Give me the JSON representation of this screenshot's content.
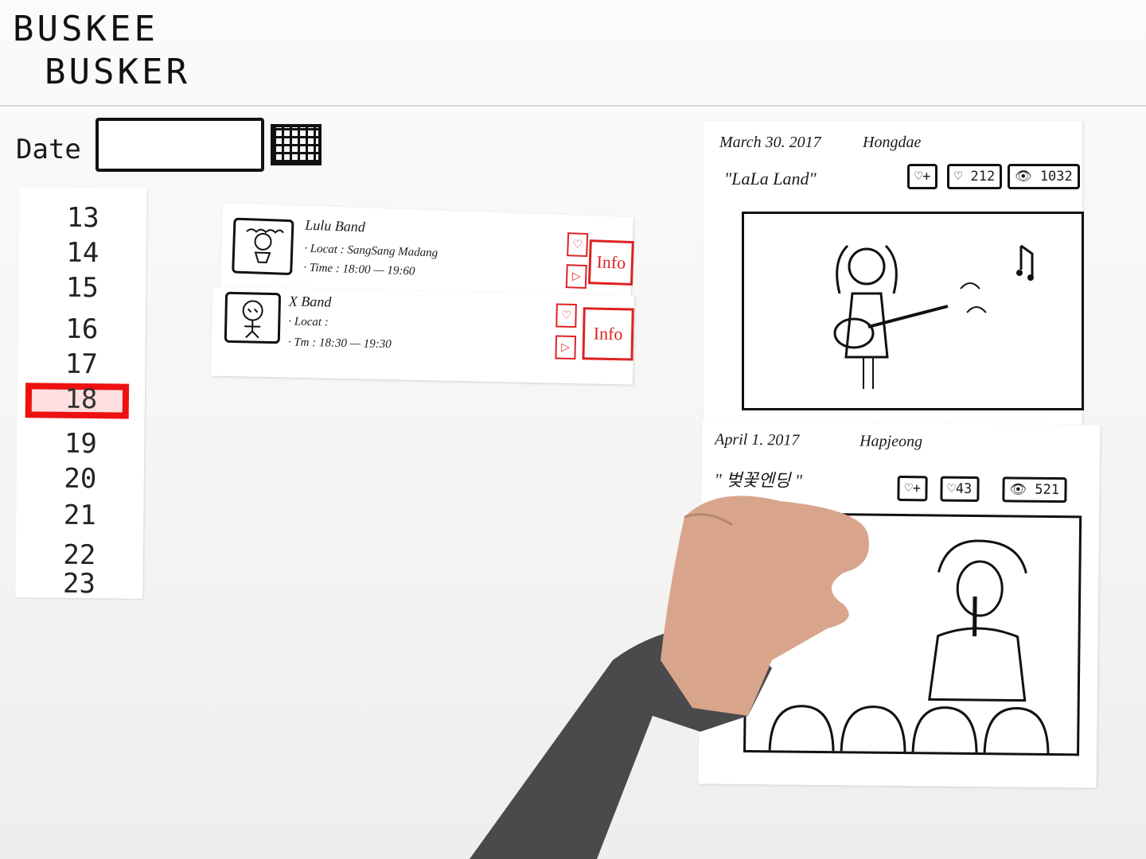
{
  "app": {
    "title_line1": "BUSKEE",
    "title_line2": "BUSKER"
  },
  "search": {
    "date_label": "Date :",
    "date_value": "",
    "calendar_icon": "calendar-icon"
  },
  "days": {
    "items": [
      "13",
      "14",
      "15",
      "16",
      "17",
      "18",
      "19",
      "20",
      "21",
      "22",
      "23"
    ],
    "selected": "18"
  },
  "bands": [
    {
      "name": "Lulu Band",
      "location": "· Locat : SangSang Madang",
      "time": "· Time : 18:00 — 19:60",
      "info_label": "Info"
    },
    {
      "name": "X Band",
      "location": "· Locat :",
      "time": "· Tm : 18:30 — 19:30",
      "info_label": "Info"
    }
  ],
  "posts": [
    {
      "date": "March 30. 2017",
      "place": "Hongdae",
      "song": "\"LaLa Land\"",
      "follow": "♡+",
      "likes": "♡ 212",
      "views": "👁 1032"
    },
    {
      "date": "April 1. 2017",
      "place": "Hapjeong",
      "song": "\" 벚꽃엔딩 \"",
      "follow": "♡+",
      "likes": "♡43",
      "views": "👁 521"
    }
  ],
  "colors": {
    "accent": "#dd2222",
    "ink": "#111111",
    "paper": "#ffffff"
  }
}
